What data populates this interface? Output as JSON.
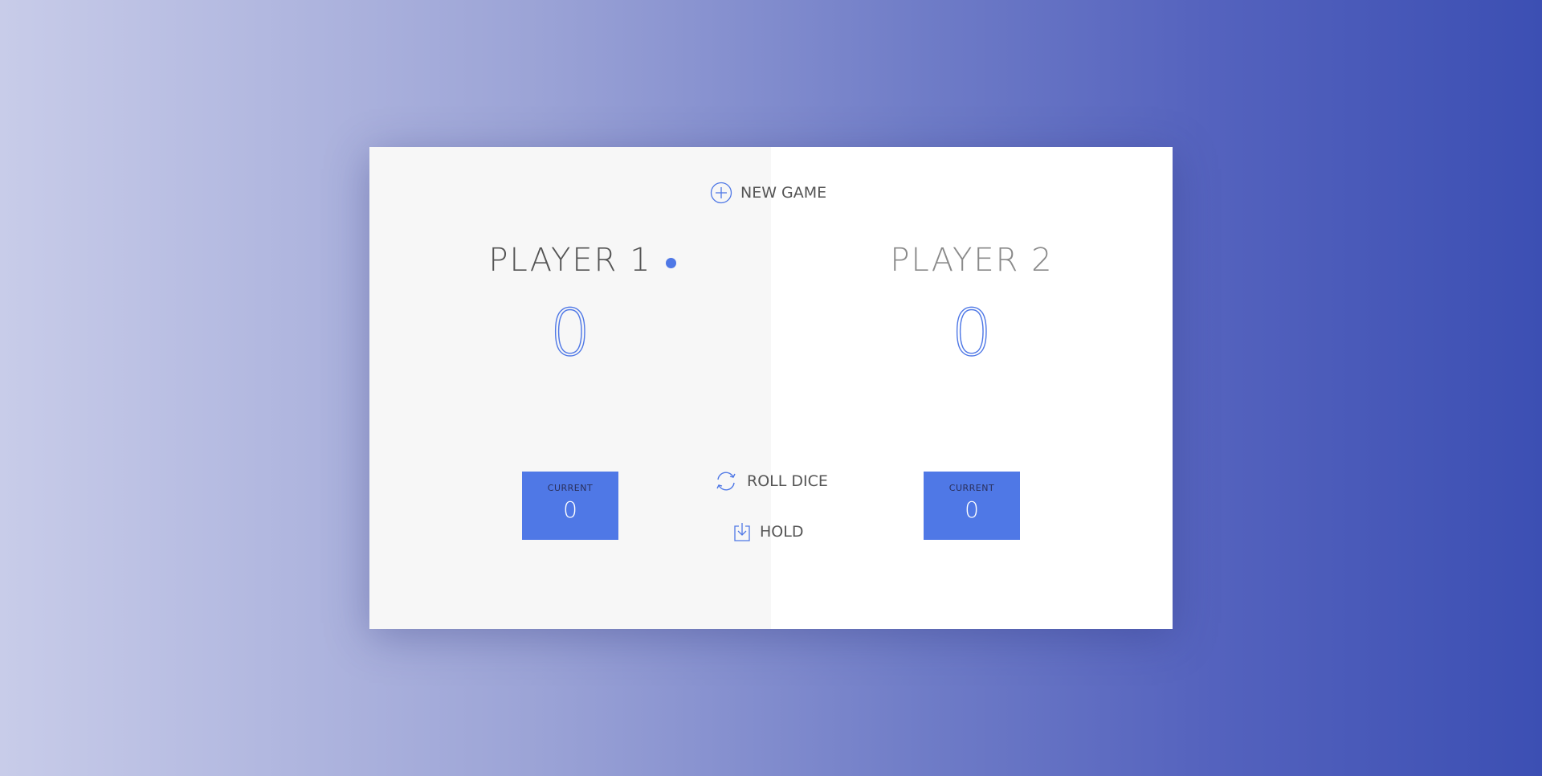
{
  "buttons": {
    "new_game": "NEW GAME",
    "roll_dice": "ROLL DICE",
    "hold": "HOLD"
  },
  "players": [
    {
      "name": "PLAYER 1",
      "score": "0",
      "current_label": "CURRENT",
      "current_score": "0",
      "active": true
    },
    {
      "name": "PLAYER 2",
      "score": "0",
      "current_label": "CURRENT",
      "current_score": "0",
      "active": false
    }
  ],
  "icons": {
    "new_game": "plus-circle-icon",
    "roll_dice": "refresh-icon",
    "hold": "download-icon",
    "active_indicator": "dot-icon"
  },
  "colors": {
    "accent": "#4f78e6",
    "active_panel": "#f7f7f7",
    "inactive_panel": "#ffffff",
    "text": "#555555"
  }
}
